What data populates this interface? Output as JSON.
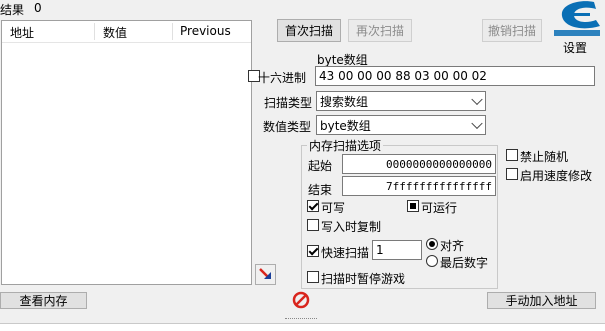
{
  "results": {
    "label": "结果",
    "count": "0"
  },
  "found_list": {
    "columns": [
      "地址",
      "数值",
      "Previous"
    ]
  },
  "buttons": {
    "first_scan": "首次扫描",
    "next_scan": "再次扫描",
    "undo_scan": "撤销扫描",
    "view_memory": "查看内存",
    "add_address": "手动加入地址"
  },
  "logo": {
    "settings_label": "设置"
  },
  "value": {
    "label": "byte数组",
    "hex_label": "十六进制",
    "input": "43 00 00 00 88 03 00 00 02"
  },
  "scan_type": {
    "label": "扫描类型",
    "selected": "搜索数组"
  },
  "value_type": {
    "label": "数值类型",
    "selected": "byte数组"
  },
  "memory_options": {
    "title": "内存扫描选项",
    "start_label": "起始",
    "start_value": "0000000000000000",
    "stop_label": "结束",
    "stop_value": "7fffffffffffffff",
    "writable": "可写",
    "executable": "可运行",
    "copy_on_write": "写入时复制",
    "fast_scan": "快速扫描",
    "fast_scan_value": "1",
    "alignment": "对齐",
    "last_digits": "最后数字",
    "pause_game": "扫描时暂停游戏"
  },
  "side_options": {
    "disable_random": "禁止随机",
    "enable_speedhack": "启用速度修改"
  },
  "colors": {
    "accent_blue": "#0a6fb5",
    "stop_red": "#d9251d"
  }
}
